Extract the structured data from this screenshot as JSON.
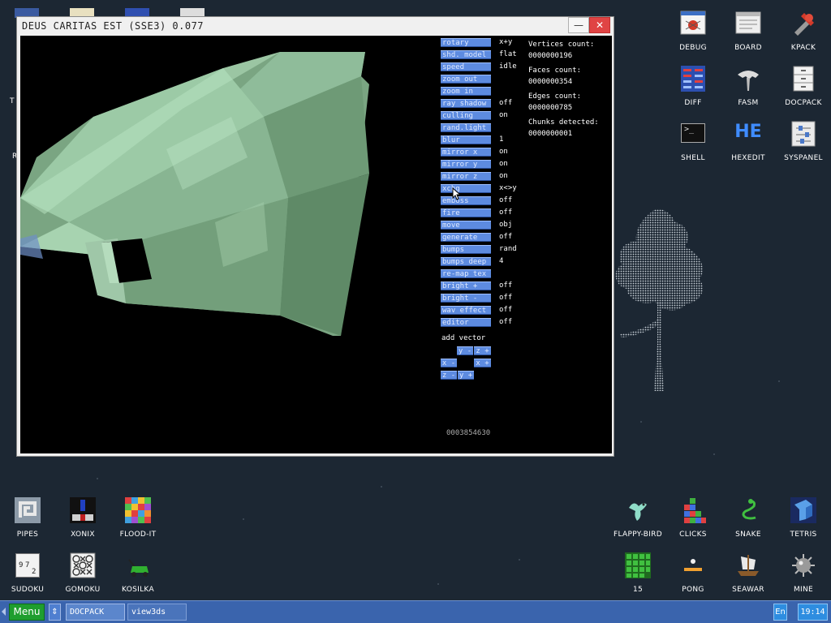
{
  "window": {
    "title": "DEUS CARITAS EST (SSE3) 0.077",
    "min_glyph": "—",
    "close_glyph": "✕"
  },
  "controls": [
    {
      "label": "rotary",
      "value": "x+y"
    },
    {
      "label": "shd. model",
      "value": "flat"
    },
    {
      "label": "speed",
      "value": "idle"
    },
    {
      "label": "zoom out",
      "value": ""
    },
    {
      "label": "zoom in",
      "value": ""
    },
    {
      "label": "ray shadow",
      "value": "off"
    },
    {
      "label": "culling",
      "value": "on"
    },
    {
      "label": "rand.light",
      "value": ""
    },
    {
      "label": "blur",
      "value": "1"
    },
    {
      "label": "mirror x",
      "value": "on"
    },
    {
      "label": "mirror y",
      "value": "on"
    },
    {
      "label": "mirror z",
      "value": "on"
    },
    {
      "label": "xchg",
      "value": "x<>y"
    },
    {
      "label": "emboss",
      "value": "off"
    },
    {
      "label": "fire",
      "value": "off"
    },
    {
      "label": "move",
      "value": "obj"
    },
    {
      "label": "generate",
      "value": "off"
    },
    {
      "label": "bumps",
      "value": "rand"
    },
    {
      "label": "bumps deep",
      "value": "4"
    },
    {
      "label": "re-map tex",
      "value": ""
    },
    {
      "label": "bright +",
      "value": "off"
    },
    {
      "label": "bright -",
      "value": "off"
    },
    {
      "label": "wav effect",
      "value": "off"
    },
    {
      "label": "editor",
      "value": "off"
    }
  ],
  "stats": {
    "vertices_label": "Vertices count:",
    "vertices_value": "0000000196",
    "faces_label": "Faces count:",
    "faces_value": "0000000354",
    "edges_label": "Edges count:",
    "edges_value": "0000000785",
    "chunks_label": "Chunks detected:",
    "chunks_value": "0000000001"
  },
  "add_vector": {
    "label": "add vector",
    "y_minus": "y -",
    "z_plus": "z +",
    "x_minus": "x -",
    "x_plus": "x +",
    "z_minus": "z -",
    "y_plus": "y +"
  },
  "counter": "0003854630",
  "desktop_left": [
    {
      "label": "PIPES"
    },
    {
      "label": "XONIX"
    },
    {
      "label": "FLOOD-IT"
    },
    {
      "label": "SUDOKU"
    },
    {
      "label": "GOMOKU"
    },
    {
      "label": "KOSILKA"
    }
  ],
  "desktop_right_top": [
    {
      "label": "DEBUG"
    },
    {
      "label": "BOARD"
    },
    {
      "label": "KPACK"
    },
    {
      "label": "DIFF"
    },
    {
      "label": "FASM"
    },
    {
      "label": "DOCPACK"
    },
    {
      "label": "SHELL"
    },
    {
      "label": "HEXEDIT"
    },
    {
      "label": "SYSPANEL"
    }
  ],
  "desktop_right_bottom": [
    {
      "label": "FLAPPY-BIRD"
    },
    {
      "label": "CLICKS"
    },
    {
      "label": "SNAKE"
    },
    {
      "label": "TETRIS"
    },
    {
      "label": "15"
    },
    {
      "label": "PONG"
    },
    {
      "label": "SEAWAR"
    },
    {
      "label": "MINE"
    }
  ],
  "edge_letters": {
    "t": "T",
    "r": "R"
  },
  "icon_text": {
    "sudoku_a": "9",
    "sudoku_b": "7",
    "sudoku_c": "2",
    "hexedit": "HE",
    "shell_prompt": ">_"
  },
  "taskbar": {
    "menu": "Menu",
    "switch_glyph": "⇕",
    "tasks": [
      "DOCPACK",
      "view3ds"
    ],
    "lang": "En",
    "clock": "19:14"
  },
  "colors": {
    "panel_button": "#5d8be0",
    "taskbar": "#3a64ad",
    "menu_button": "#1f9e2f",
    "close_button": "#e04444"
  }
}
